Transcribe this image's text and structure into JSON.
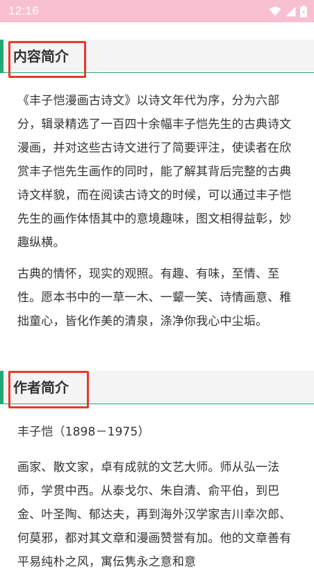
{
  "status_bar": {
    "time": "12:16",
    "icons": [
      "wifi-icon",
      "cellular-signal-icon",
      "battery-charging-icon"
    ],
    "background": "#f8bfd0"
  },
  "sections": [
    {
      "title": "内容简介",
      "paragraphs": [
        "《丰子恺漫画古诗文》以诗文年代为序，分为六部分，辑录精选了一百四十余幅丰子恺先生的古典诗文漫画，并对这些古诗文进行了简要评注，使读者在欣赏丰子恺先生画作的同时，能了解其背后完整的古典诗文样貌，而在阅读古诗文的时候，可以通过丰子恺先生的画作体悟其中的意境趣味，图文相得益彰，妙趣纵横。",
        "古典的情怀，现实的观照。有趣、有味，至情、至性。愿本书中的一草一木、一颦一笑、诗情画意、稚拙童心，皆化作美的清泉，涤净你我心中尘垢。"
      ]
    },
    {
      "title": "作者简介",
      "paragraphs": [
        "丰子恺（1898－1975）",
        "画家、散文家，卓有成就的文艺大师。师从弘一法师，学贯中西。从泰戈尔、朱自清、俞平伯，到巴金、叶圣陶、郁达夫，再到海外汉学家吉川幸次郎、何莫邪，都对其文章和漫画赞誉有加。他的文章善有平易纯朴之风，寓伝隽永之意和意"
      ]
    }
  ],
  "colors": {
    "accent": "#23a871",
    "highlight": "#e53a2a",
    "text": "#333333",
    "header_bg": "#f4f4f4"
  }
}
